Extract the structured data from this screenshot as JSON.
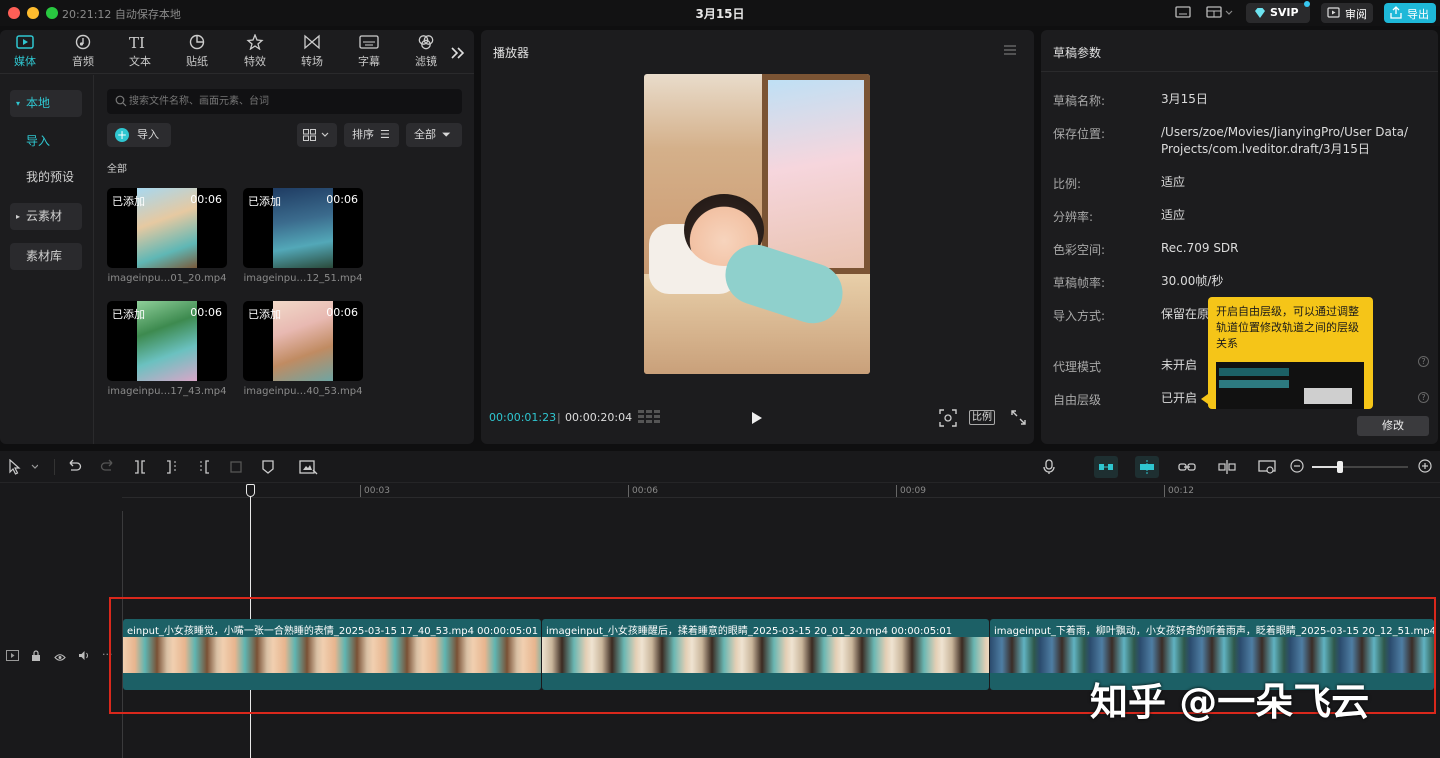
{
  "titlebar": {
    "autosave": "20:21:12 自动保存本地",
    "project_title": "3月15日",
    "svip_label": "SVIP",
    "review_label": "审阅",
    "export_label": "导出"
  },
  "media_panel": {
    "tools": [
      {
        "label": "媒体",
        "icon": "media-icon",
        "active": true
      },
      {
        "label": "音频",
        "icon": "audio-icon"
      },
      {
        "label": "文本",
        "icon": "text-icon"
      },
      {
        "label": "贴纸",
        "icon": "sticker-icon"
      },
      {
        "label": "特效",
        "icon": "effects-icon"
      },
      {
        "label": "转场",
        "icon": "transition-icon"
      },
      {
        "label": "字幕",
        "icon": "subtitle-icon"
      },
      {
        "label": "滤镜",
        "icon": "filter-icon"
      }
    ],
    "nav": {
      "local": "本地",
      "import": "导入",
      "presets": "我的预设",
      "cloud": "云素材",
      "library": "素材库"
    },
    "search_placeholder": "搜索文件名称、画面元素、台词",
    "import_button": "导入",
    "sort_label": "排序",
    "filter_all": "全部",
    "section_all": "全部",
    "items": [
      {
        "badge": "已添加",
        "duration": "00:06",
        "name": "imageinpu…01_20.mp4"
      },
      {
        "badge": "已添加",
        "duration": "00:06",
        "name": "imageinpu…12_51.mp4"
      },
      {
        "badge": "已添加",
        "duration": "00:06",
        "name": "imageinpu…17_43.mp4"
      },
      {
        "badge": "已添加",
        "duration": "00:06",
        "name": "imageinpu…40_53.mp4"
      }
    ]
  },
  "player": {
    "title": "播放器",
    "current_time": "00:00:01:23",
    "total_time": "00:00:20:04",
    "ratio_label": "比例"
  },
  "draft": {
    "title": "草稿参数",
    "rows": [
      {
        "label": "草稿名称:",
        "value": "3月15日"
      },
      {
        "label": "保存位置:",
        "value": "/Users/zoe/Movies/JianyingPro/User Data/ Projects/com.lveditor.draft/3月15日"
      },
      {
        "label": "比例:",
        "value": "适应"
      },
      {
        "label": "分辨率:",
        "value": "适应"
      },
      {
        "label": "色彩空间:",
        "value": "Rec.709 SDR"
      },
      {
        "label": "草稿帧率:",
        "value": "30.00帧/秒"
      },
      {
        "label": "导入方式:",
        "value": "保留在原"
      },
      {
        "label": "代理模式",
        "value": "未开启"
      },
      {
        "label": "自由层级",
        "value": "已开启"
      }
    ],
    "tooltip": "开启自由层级，可以通过调整轨道位置修改轨道之间的层级关系",
    "modify_button": "修改"
  },
  "timeline": {
    "ticks": [
      "00:03",
      "00:06",
      "00:09",
      "00:12"
    ],
    "clips": [
      {
        "label": "einput_小女孩睡觉，小嘴一张一合熟睡的表情_2025-03-15 17_40_53.mp4   00:00:05:01"
      },
      {
        "label": "imageinput_小女孩睡醒后，揉着睡意的眼睛_2025-03-15 20_01_20.mp4   00:00:05:01"
      },
      {
        "label": "imageinput_下着雨，柳叶飘动，小女孩好奇的听着雨声，眨着眼睛_2025-03-15 20_12_51.mp4"
      }
    ]
  },
  "watermark": "知乎 @一朵飞云",
  "colors": {
    "accent": "#2fc6d0",
    "clip": "#1c6066",
    "highlight_border": "#d9281c",
    "tooltip_bg": "#f5c518"
  }
}
